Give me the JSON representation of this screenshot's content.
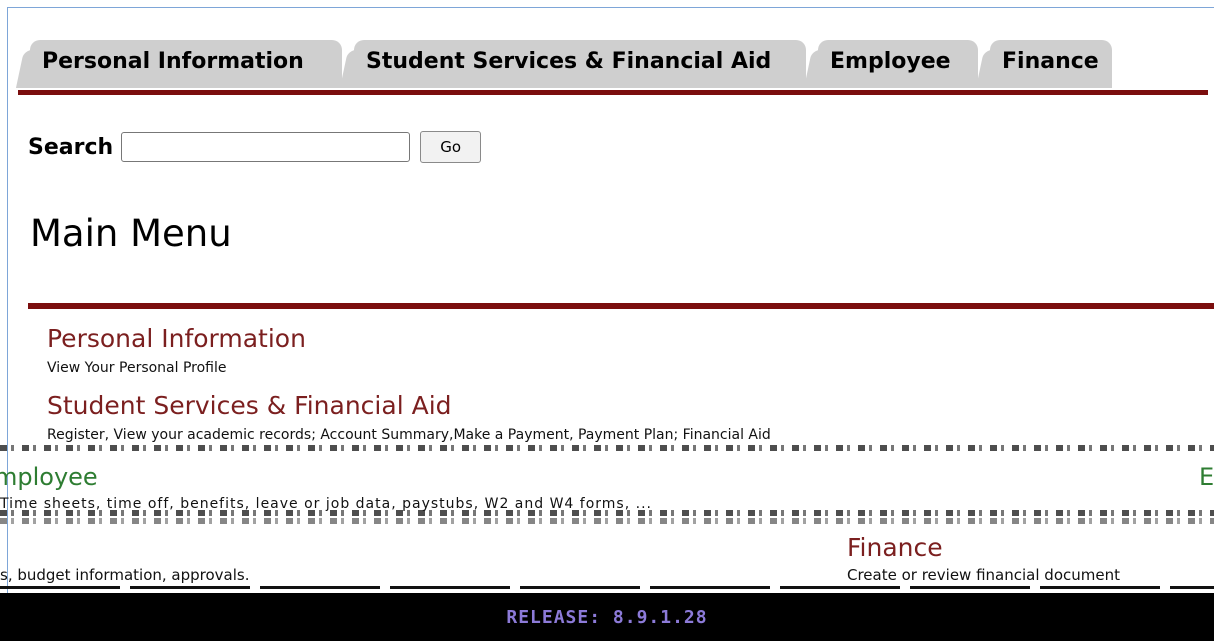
{
  "tabs": [
    {
      "label": "Personal Information"
    },
    {
      "label": "Student Services & Financial Aid"
    },
    {
      "label": "Employee"
    },
    {
      "label": "Finance"
    }
  ],
  "search": {
    "label": "Search",
    "value": "",
    "button": "Go"
  },
  "page_title": "Main Menu",
  "menu": [
    {
      "title": "Personal Information",
      "description": "View Your Personal Profile"
    },
    {
      "title": "Student Services & Financial Aid",
      "description": "Register, View your academic records; Account Summary,Make a Payment, Payment Plan; Financial Aid"
    },
    {
      "title": "mployee",
      "title_right": "E",
      "description": "Time sheets, time off, benefits, leave or job data, paystubs, W2 and W4 forms, ..."
    },
    {
      "title": "Finance",
      "description": "Create or review financial document",
      "left_description": "s, budget information, approvals."
    }
  ],
  "footer": {
    "release": "RELEASE: 8.9.1.28"
  },
  "colors": {
    "tab_rule": "#7b0e0e",
    "link": "#7b1f1f",
    "employee_link": "#2e7d32",
    "release_text": "#8c7ad8"
  }
}
